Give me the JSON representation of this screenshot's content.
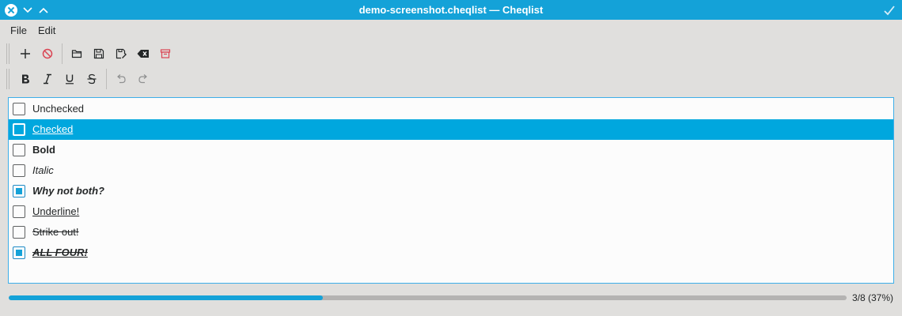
{
  "window": {
    "title": "demo-screenshot.cheqlist — Cheqlist",
    "controls": [
      "close-icon",
      "chevron-down-icon",
      "chevron-up-icon"
    ],
    "accent": "#14a2d8"
  },
  "menu": [
    {
      "label": "File"
    },
    {
      "label": "Edit"
    }
  ],
  "toolbar1": [
    "add-icon",
    "cancel-icon",
    "open-folder-icon",
    "save-icon",
    "save-as-icon",
    "clear-icon",
    "archive-icon"
  ],
  "toolbar2": [
    "bold-icon",
    "italic-icon",
    "underline-icon",
    "strikethrough-icon",
    "undo-icon",
    "redo-icon"
  ],
  "items": [
    {
      "label": "Unchecked",
      "checked": false,
      "style": "plain"
    },
    {
      "label": "Checked",
      "checked": false,
      "style": "plain",
      "selected": true
    },
    {
      "label": "Bold",
      "checked": false,
      "style": "bold"
    },
    {
      "label": "Italic",
      "checked": false,
      "style": "italic"
    },
    {
      "label": "Why not both?",
      "checked": true,
      "style": "bold-italic"
    },
    {
      "label": "Underline!",
      "checked": false,
      "style": "underline"
    },
    {
      "label": "Strike out!",
      "checked": false,
      "style": "strike"
    },
    {
      "label": "ALL FOUR!",
      "checked": true,
      "style": "all"
    }
  ],
  "progress": {
    "text": "3/8 (37%)",
    "fraction": 0.375
  }
}
